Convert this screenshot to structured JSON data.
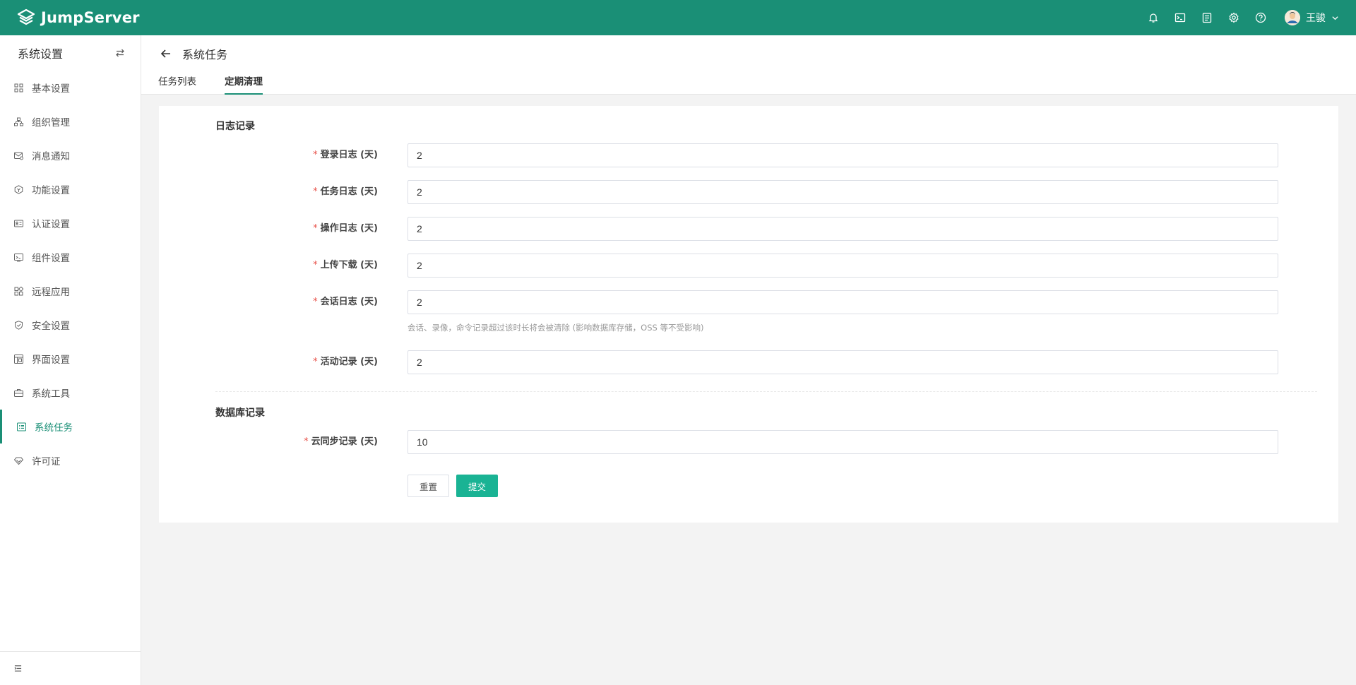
{
  "header": {
    "brand": "JumpServer",
    "user_name": "王骏",
    "icons": [
      "bell-icon",
      "terminal-icon",
      "notes-icon",
      "gear-icon",
      "help-icon"
    ]
  },
  "sidebar": {
    "title": "系统设置",
    "items": [
      {
        "label": "基本设置",
        "icon": "grid-icon"
      },
      {
        "label": "组织管理",
        "icon": "org-tree-icon"
      },
      {
        "label": "消息通知",
        "icon": "message-icon"
      },
      {
        "label": "功能设置",
        "icon": "feature-icon"
      },
      {
        "label": "认证设置",
        "icon": "id-card-icon"
      },
      {
        "label": "组件设置",
        "icon": "component-icon"
      },
      {
        "label": "远程应用",
        "icon": "apps-icon"
      },
      {
        "label": "安全设置",
        "icon": "shield-icon"
      },
      {
        "label": "界面设置",
        "icon": "layout-icon"
      },
      {
        "label": "系统工具",
        "icon": "toolbox-icon"
      },
      {
        "label": "系统任务",
        "icon": "task-list-icon",
        "active": true
      },
      {
        "label": "许可证",
        "icon": "license-icon"
      }
    ]
  },
  "page": {
    "title": "系统任务",
    "tabs": [
      {
        "label": "任务列表",
        "active": false
      },
      {
        "label": "定期清理",
        "active": true
      }
    ]
  },
  "form": {
    "section_logs": "日志记录",
    "fields": [
      {
        "label": "登录日志 (天)",
        "value": "2"
      },
      {
        "label": "任务日志 (天)",
        "value": "2"
      },
      {
        "label": "操作日志 (天)",
        "value": "2"
      },
      {
        "label": "上传下载 (天)",
        "value": "2"
      },
      {
        "label": "会话日志 (天)",
        "value": "2",
        "help": "会话、录像，命令记录超过该时长将会被清除 (影响数据库存储，OSS 等不受影响)"
      },
      {
        "label": "活动记录 (天)",
        "value": "2"
      }
    ],
    "section_db": "数据库记录",
    "db_fields": [
      {
        "label": "云同步记录 (天)",
        "value": "10"
      }
    ],
    "required_mark": "*",
    "reset_label": "重置",
    "submit_label": "提交"
  },
  "colors": {
    "brand": "#1a8f76",
    "primary_button": "#1ab394",
    "required": "#e8534b"
  }
}
